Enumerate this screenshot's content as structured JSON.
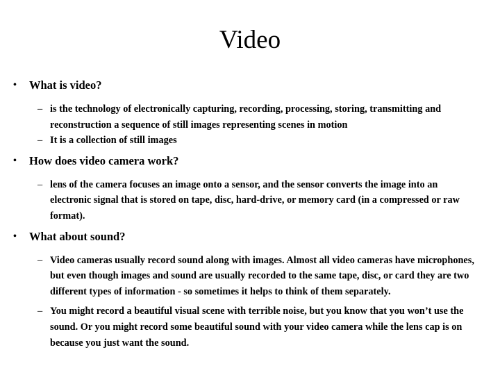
{
  "slide": {
    "title": "Video",
    "bullet_marker": "•",
    "dash_marker": "–",
    "sections": [
      {
        "heading": "What is video?",
        "points": [
          "is the technology of electronically capturing, recording, processing, storing, transmitting and reconstruction a sequence of still images representing scenes in motion",
          "It is a collection of still images"
        ]
      },
      {
        "heading": "How does video camera work?",
        "points": [
          "lens of the camera focuses an image onto a sensor, and the sensor converts the image into an electronic signal that is stored on tape, disc, hard-drive, or memory card (in a compressed or raw format)."
        ]
      },
      {
        "heading": "What about sound?",
        "points": [
          "Video cameras usually record sound along with images. Almost all video cameras have microphones, but even though images and sound are usually recorded to the same tape, disc, or card they are two different types of information - so sometimes it helps to think of them separately.",
          "You might record a beautiful visual scene with terrible noise, but you know that you won’t use the sound. Or you might record some beautiful sound with your video camera while the lens cap is on because you just want the sound."
        ]
      }
    ],
    "colors": {
      "background": "#ffffff",
      "text": "#000000"
    }
  }
}
